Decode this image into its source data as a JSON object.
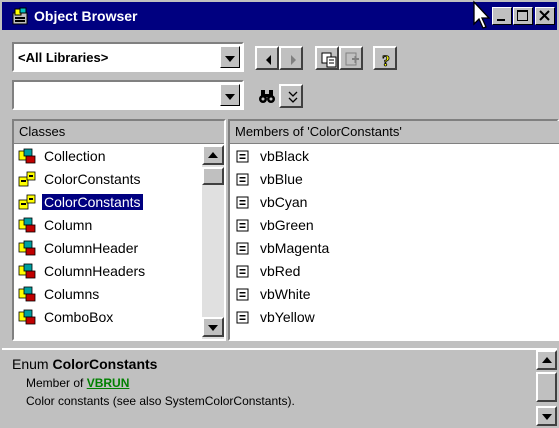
{
  "window": {
    "title": "Object Browser",
    "minimize": "minimize-icon",
    "maximize": "maximize-icon",
    "close": "close-icon"
  },
  "toolbar": {
    "library_combo": {
      "value": "<All Libraries>"
    },
    "search_combo": {
      "value": ""
    },
    "buttons": [
      "back-icon",
      "forward-icon",
      "copy-icon",
      "view-definition-icon",
      "help-icon",
      "find-icon",
      "show-search-results-icon"
    ]
  },
  "classes": {
    "header": "Classes",
    "items": [
      {
        "label": "Collection",
        "icon": "class-icon",
        "selected": false
      },
      {
        "label": "ColorConstants",
        "icon": "enum-icon",
        "selected": false
      },
      {
        "label": "ColorConstants",
        "icon": "enum-icon",
        "selected": true
      },
      {
        "label": "Column",
        "icon": "class-icon",
        "selected": false
      },
      {
        "label": "ColumnHeader",
        "icon": "class-icon",
        "selected": false
      },
      {
        "label": "ColumnHeaders",
        "icon": "class-icon",
        "selected": false
      },
      {
        "label": "Columns",
        "icon": "class-icon",
        "selected": false
      },
      {
        "label": "ComboBox",
        "icon": "class-icon",
        "selected": false
      }
    ]
  },
  "members": {
    "header": "Members of 'ColorConstants'",
    "items": [
      "vbBlack",
      "vbBlue",
      "vbCyan",
      "vbGreen",
      "vbMagenta",
      "vbRed",
      "vbWhite",
      "vbYellow"
    ],
    "icon": "constant-icon"
  },
  "details": {
    "kind": "Enum",
    "name": "ColorConstants",
    "member_of_label": "Member of",
    "library": "VBRUN",
    "description": "Color constants (see also SystemColorConstants)."
  }
}
